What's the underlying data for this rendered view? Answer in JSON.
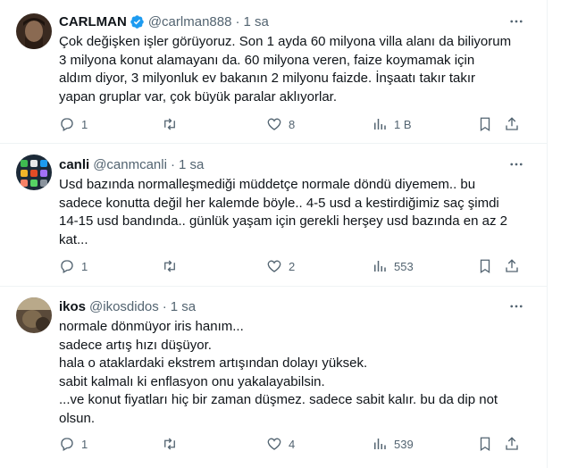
{
  "tweets": [
    {
      "name": "CARLMAN",
      "handle": "@carlman888",
      "time": "1 sa",
      "verified": true,
      "text": "Çok değişken işler görüyoruz. Son 1 ayda 60 milyona villa alanı da biliyorum\n3 milyona konut alamayanı da. 60 milyona veren, faize koymamak için\naldım diyor, 3 milyonluk ev bakanın 2 milyonu faizde. İnşaatı takır takır\nyapan gruplar var, çok büyük paralar aklıyorlar.",
      "replies": "1",
      "retweets": "",
      "likes": "8",
      "views": "1 B"
    },
    {
      "name": "canli",
      "handle": "@canmcanli",
      "time": "1 sa",
      "verified": false,
      "text": "Usd bazında normalleşmediği müddetçe normale döndü diyemem.. bu\nsadece konutta değil her kalemde böyle.. 4-5 usd a kestirdiğimiz saç şimdi\n14-15 usd bandında.. günlük yaşam için gerekli herşey usd bazında en az 2\nkat...",
      "replies": "1",
      "retweets": "",
      "likes": "2",
      "views": "553"
    },
    {
      "name": "ikos",
      "handle": "@ikosdidos",
      "time": "1 sa",
      "verified": false,
      "text": "normale dönmüyor iris hanım...\nsadece artış hızı düşüyor.\nhala o ataklardaki ekstrem artışından dolayı yüksek.\nsabit kalmalı ki enflasyon onu yakalayabilsin.\n...ve konut fiyatları hiç bir zaman düşmez. sadece sabit kalır. bu da dip not\nolsun.",
      "replies": "1",
      "retweets": "",
      "likes": "4",
      "views": "539"
    }
  ],
  "icons": {
    "reply": "reply-icon",
    "retweet": "retweet-icon",
    "like": "heart-icon",
    "views": "analytics-icon",
    "bookmark": "bookmark-icon",
    "share": "share-icon",
    "more": "more-icon",
    "verified": "verified-badge-icon"
  },
  "colors": {
    "secondary_text": "#536471",
    "verified_blue": "#1d9bf0",
    "divider": "#eff3f4"
  }
}
